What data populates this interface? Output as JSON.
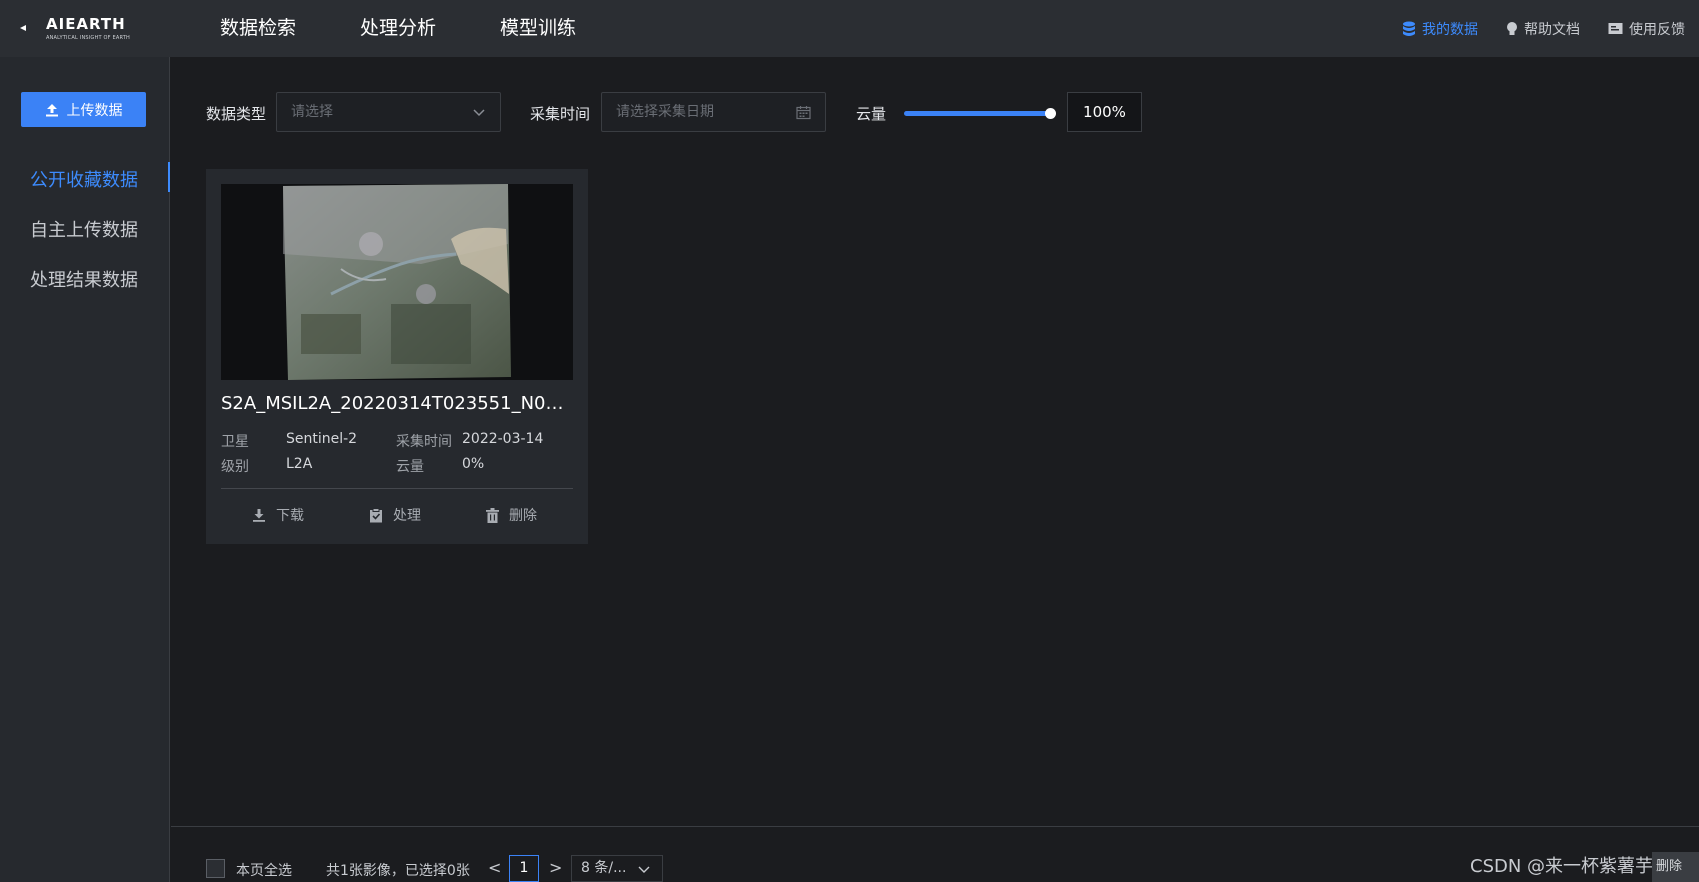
{
  "header": {
    "logo_brand": "AIEARTH",
    "logo_tagline": "ANALYTICAL INSIGHT OF EARTH",
    "nav": [
      {
        "label": "数据检索"
      },
      {
        "label": "处理分析"
      },
      {
        "label": "模型训练"
      }
    ],
    "right_nav": [
      {
        "label": "我的数据",
        "icon": "database-icon",
        "active": true
      },
      {
        "label": "帮助文档",
        "icon": "lightbulb-icon"
      },
      {
        "label": "使用反馈",
        "icon": "feedback-icon"
      }
    ]
  },
  "sidebar": {
    "upload_label": "上传数据",
    "items": [
      {
        "label": "公开收藏数据",
        "active": true
      },
      {
        "label": "自主上传数据"
      },
      {
        "label": "处理结果数据"
      }
    ]
  },
  "filters": {
    "data_type_label": "数据类型",
    "data_type_placeholder": "请选择",
    "time_label": "采集时间",
    "time_placeholder": "请选择采集日期",
    "cloud_label": "云量",
    "cloud_value": "100%",
    "cloud_slider_fraction": 1.0
  },
  "cards": [
    {
      "title": "S2A_MSIL2A_20220314T023551_N0400_...",
      "satellite_key": "卫星",
      "satellite_value": "Sentinel-2",
      "level_key": "级别",
      "level_value": "L2A",
      "time_key": "采集时间",
      "time_value": "2022-03-14",
      "cloud_key": "云量",
      "cloud_value": "0%",
      "actions": {
        "download": "下载",
        "process": "处理",
        "delete": "删除"
      }
    }
  ],
  "footer": {
    "select_all": "本页全选",
    "summary": "共1张影像，已选择0张",
    "prev": "<",
    "page": "1",
    "next": ">",
    "page_size": "8 条/...",
    "watermark": "CSDN @来一杯紫薯芋泥",
    "corner_label": "删除"
  },
  "colors": {
    "accent": "#3b82f6",
    "topbar": "#2b2e33",
    "sidebar": "#26292e",
    "background": "#1b1c1f"
  }
}
